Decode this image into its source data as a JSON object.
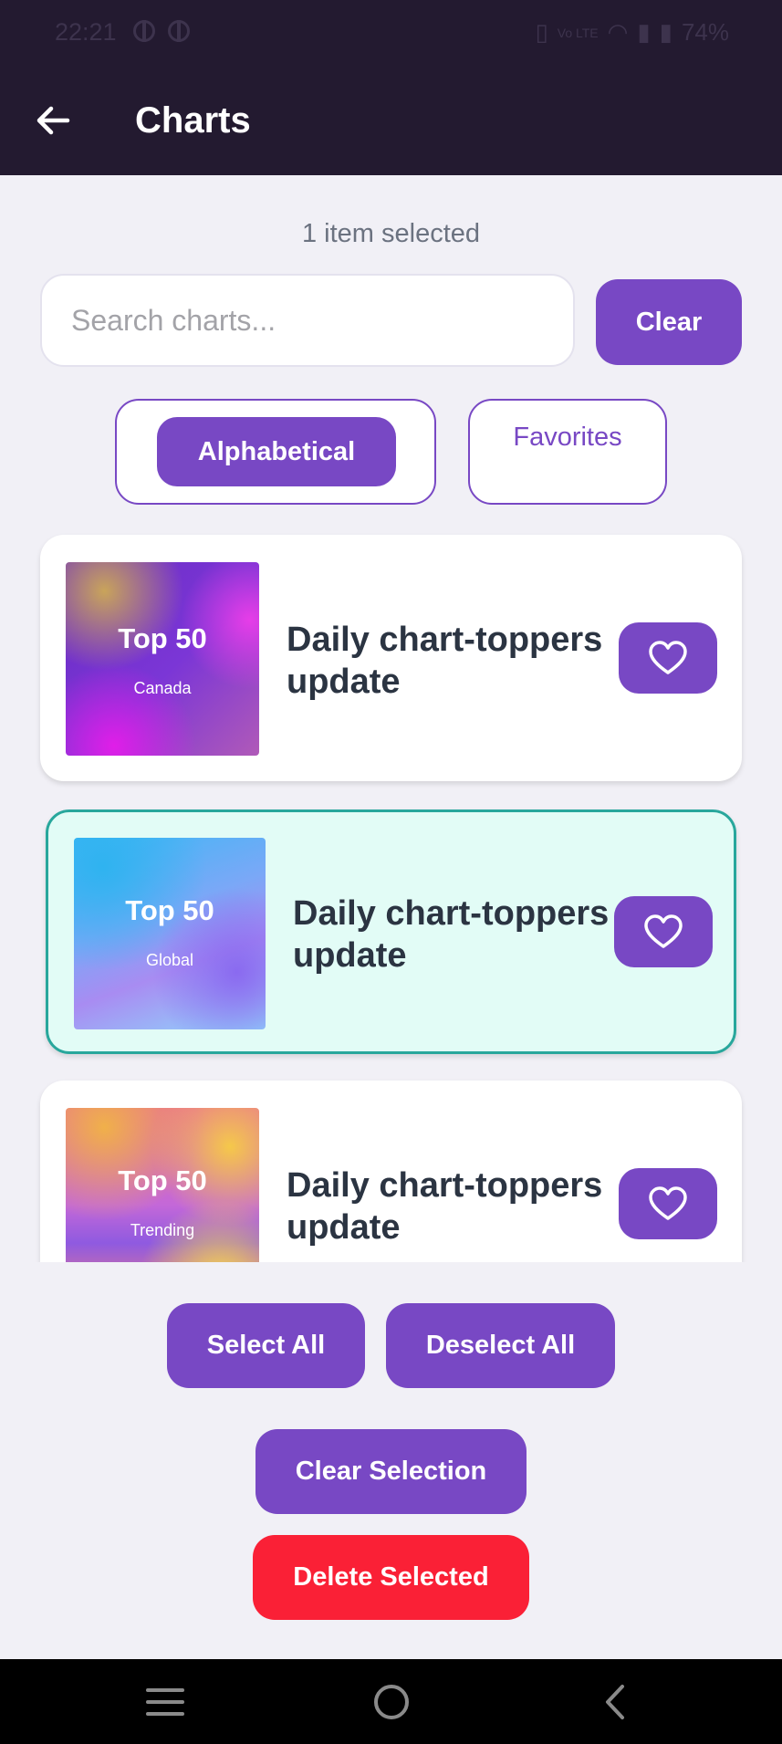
{
  "status": {
    "time": "22:21",
    "battery": "74%"
  },
  "header": {
    "title": "Charts"
  },
  "selection": {
    "count_text": "1 item selected"
  },
  "search": {
    "placeholder": "Search charts...",
    "value": "",
    "clear_label": "Clear"
  },
  "sort": {
    "alphabetical_label": "Alphabetical",
    "favorites_label": "Favorites",
    "active": "Alphabetical"
  },
  "charts": [
    {
      "thumb_title": "Top 50",
      "thumb_subtitle": "Canada",
      "title": "Daily chart-toppers update",
      "selected": false,
      "favorite": false
    },
    {
      "thumb_title": "Top 50",
      "thumb_subtitle": "Global",
      "title": "Daily chart-toppers update",
      "selected": true,
      "favorite": false
    },
    {
      "thumb_title": "Top 50",
      "thumb_subtitle": "Trending",
      "title": "Daily chart-toppers update",
      "selected": false,
      "favorite": false
    }
  ],
  "actions": {
    "select_all": "Select All",
    "deselect_all": "Deselect All",
    "clear_selection": "Clear Selection",
    "delete_selected": "Delete Selected"
  },
  "colors": {
    "accent": "#7848c4",
    "header_bg": "#231a30",
    "danger": "#fa2036",
    "selected_bg": "#e2fcf6",
    "selected_border": "#28a79c"
  }
}
